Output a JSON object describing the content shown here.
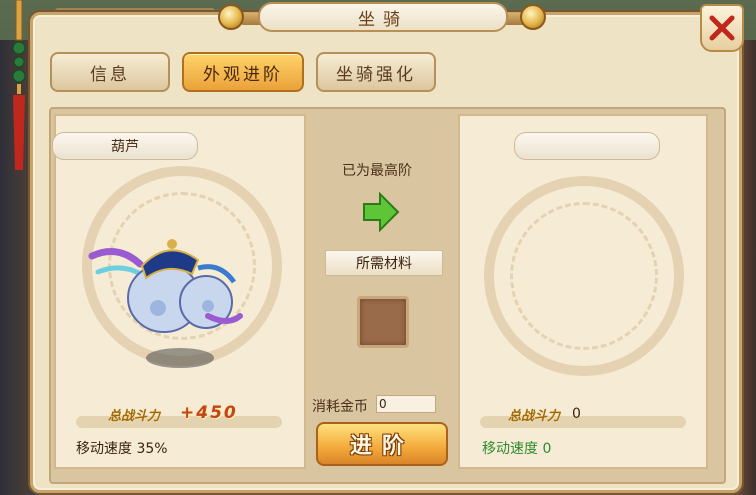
{
  "window": {
    "title": "坐骑"
  },
  "tabs": [
    {
      "label": "信息",
      "active": false
    },
    {
      "label": "外观进阶",
      "active": true
    },
    {
      "label": "坐骑强化",
      "active": false
    }
  ],
  "left_card": {
    "mount_name": "葫芦",
    "power_label": "总战斗力",
    "power_value": "+450",
    "speed_text": "移动速度 35%"
  },
  "right_card": {
    "mount_name": "",
    "power_label": "总战斗力",
    "power_value": "0",
    "speed_text": "移动速度 0"
  },
  "middle": {
    "max_stage_text": "已为最高阶",
    "materials_label": "所需材料",
    "coin_cost_label": "消耗金币",
    "coin_cost_value": "0",
    "advance_button": "进阶"
  },
  "colors": {
    "accent_gold": "#f3a93a",
    "speed_green": "#2e8b2e",
    "panel_bg": "#efe3c6"
  }
}
